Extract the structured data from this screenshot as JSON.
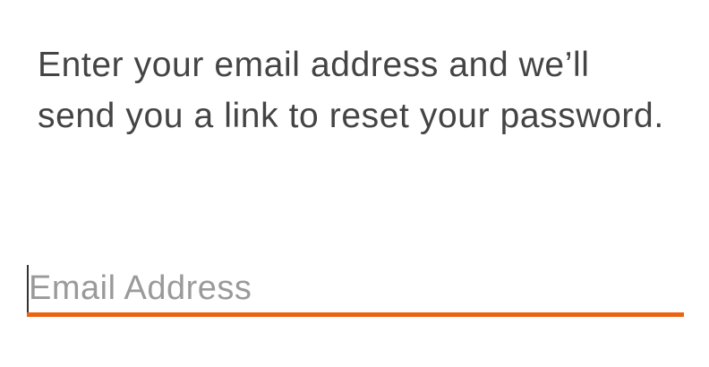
{
  "form": {
    "instructions": "Enter your email address and we’ll send you a link to reset your password.",
    "email_placeholder": "Email Address",
    "email_value": ""
  },
  "colors": {
    "accent": "#ec6412",
    "text": "#444444",
    "placeholder": "#9a9a9a"
  }
}
